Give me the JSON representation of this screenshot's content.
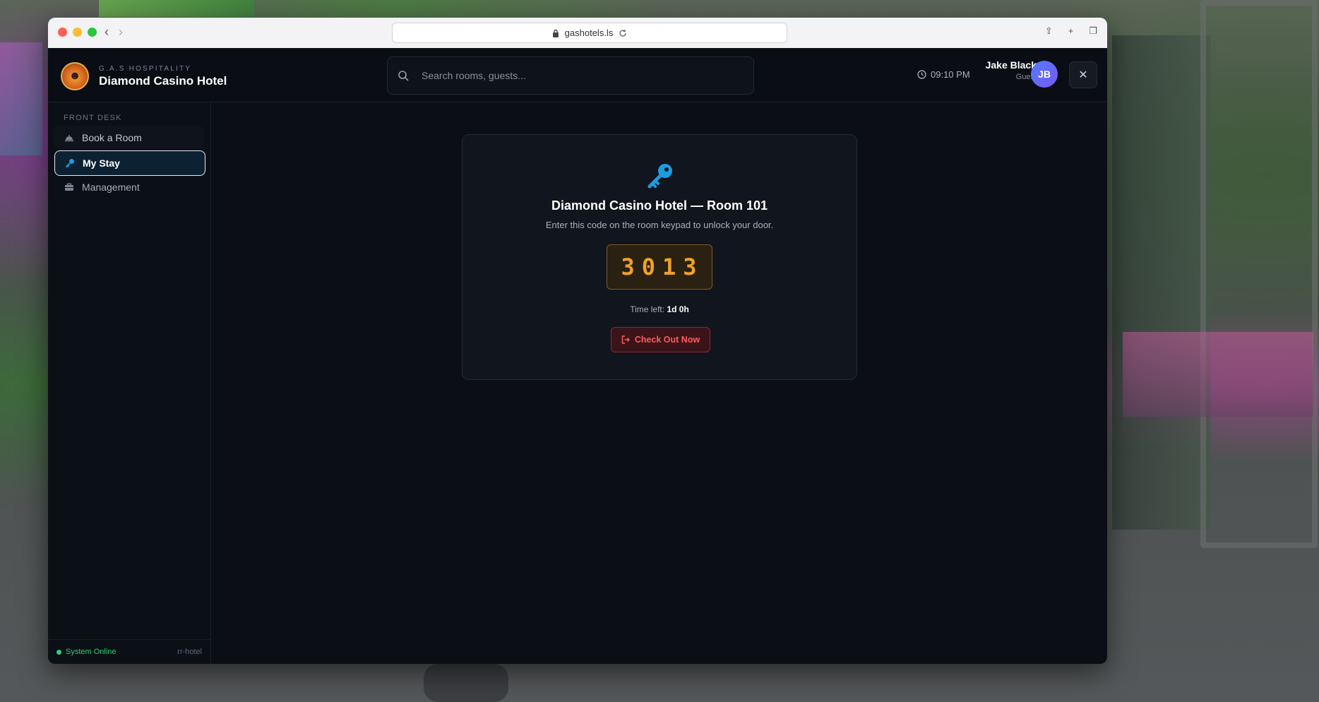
{
  "browser": {
    "url": "gashotels.ls"
  },
  "header": {
    "brand_sub": "G.A.S HOSPITALITY",
    "brand_title": "Diamond Casino Hotel",
    "search_placeholder": "Search rooms, guests...",
    "clock": "09:10 PM",
    "user_name": "Jake Black",
    "user_role": "Guest",
    "avatar_initials": "JB"
  },
  "sidebar": {
    "section": "FRONT DESK",
    "items": [
      {
        "label": "Book a Room",
        "icon": "bell-icon"
      },
      {
        "label": "My Stay",
        "icon": "key-icon",
        "active": true
      },
      {
        "label": "Management",
        "icon": "briefcase-icon"
      }
    ],
    "status": "System Online",
    "version": "rr-hotel"
  },
  "stay": {
    "title": "Diamond Casino Hotel — Room 101",
    "subtitle": "Enter this code on the room keypad to unlock your door.",
    "code": "3013",
    "time_left_label": "Time left:",
    "time_left_value": "1d 0h",
    "checkout_label": "Check Out Now"
  },
  "colors": {
    "accent": "#1e9be0",
    "code": "#f0a02a",
    "danger": "#ff5a5f",
    "online": "#2fcf74"
  }
}
